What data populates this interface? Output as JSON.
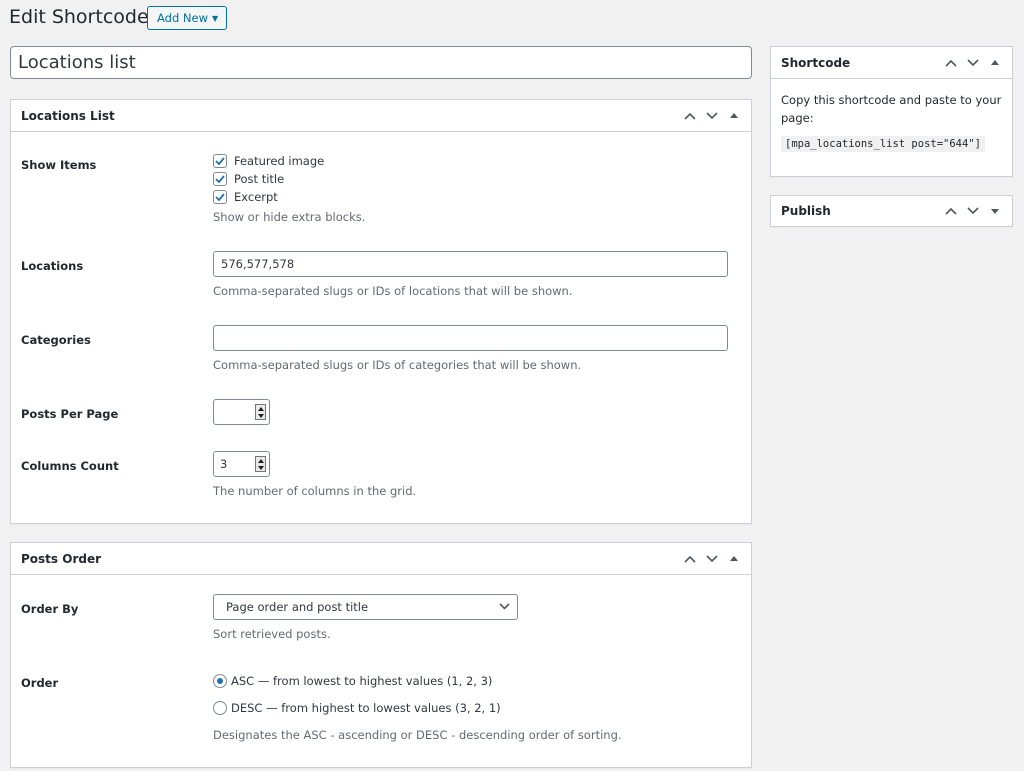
{
  "header": {
    "title": "Edit Shortcode",
    "add_new_label": "Add New"
  },
  "post_title": "Locations list",
  "locations_box": {
    "title": "Locations List",
    "show_items": {
      "label": "Show Items",
      "options": [
        {
          "label": "Featured image",
          "checked": true
        },
        {
          "label": "Post title",
          "checked": true
        },
        {
          "label": "Excerpt",
          "checked": true
        }
      ],
      "description": "Show or hide extra blocks."
    },
    "locations": {
      "label": "Locations",
      "value": "576,577,578",
      "description": "Comma-separated slugs or IDs of locations that will be shown."
    },
    "categories": {
      "label": "Categories",
      "value": "",
      "description": "Comma-separated slugs or IDs of categories that will be shown."
    },
    "posts_per_page": {
      "label": "Posts Per Page",
      "value": ""
    },
    "columns_count": {
      "label": "Columns Count",
      "value": "3",
      "description": "The number of columns in the grid."
    }
  },
  "order_box": {
    "title": "Posts Order",
    "order_by": {
      "label": "Order By",
      "selected": "Page order and post title",
      "description": "Sort retrieved posts."
    },
    "order": {
      "label": "Order",
      "options": [
        {
          "label": "ASC — from lowest to highest values (1, 2, 3)",
          "checked": true
        },
        {
          "label": "DESC — from highest to lowest values (3, 2, 1)",
          "checked": false
        }
      ],
      "description": "Designates the ASC - ascending or DESC - descending order of sorting."
    }
  },
  "sidebar": {
    "shortcode_box": {
      "title": "Shortcode",
      "instruction": "Copy this shortcode and paste to your page:",
      "code": "[mpa_locations_list post=\"644\"]"
    },
    "publish_box": {
      "title": "Publish"
    }
  },
  "colors": {
    "accent": "#0071a1",
    "checkbox_check": "#2271b1"
  }
}
